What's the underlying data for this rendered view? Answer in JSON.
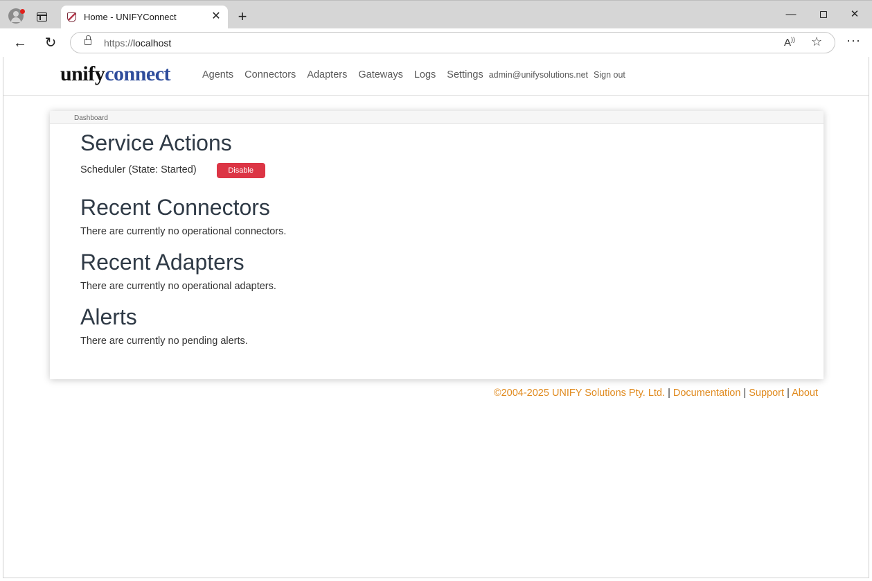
{
  "browser": {
    "tab_title": "Home - UNIFYConnect",
    "url_scheme": "https://",
    "url_host": "localhost"
  },
  "app": {
    "brand_part1": "unify",
    "brand_part2": "connect",
    "nav": [
      "Agents",
      "Connectors",
      "Adapters",
      "Gateways",
      "Logs",
      "Settings"
    ],
    "user": "admin@unifysolutions.net",
    "signout": "Sign out"
  },
  "breadcrumb": "Dashboard",
  "sections": {
    "service_actions": {
      "title": "Service Actions",
      "scheduler_text": "Scheduler (State: Started)",
      "disable_label": "Disable"
    },
    "recent_connectors": {
      "title": "Recent Connectors",
      "message": "There are currently no operational connectors."
    },
    "recent_adapters": {
      "title": "Recent Adapters",
      "message": "There are currently no operational adapters."
    },
    "alerts": {
      "title": "Alerts",
      "message": "There are currently no pending alerts."
    }
  },
  "footer": {
    "copyright": "©2004-2025 UNIFY Solutions Pty. Ltd.",
    "sep": "|",
    "documentation": "Documentation",
    "support": "Support",
    "about": "About"
  },
  "colors": {
    "brand_connect": "#2e4c9b",
    "danger": "#dc3545",
    "footer_link": "#e08a1e"
  }
}
